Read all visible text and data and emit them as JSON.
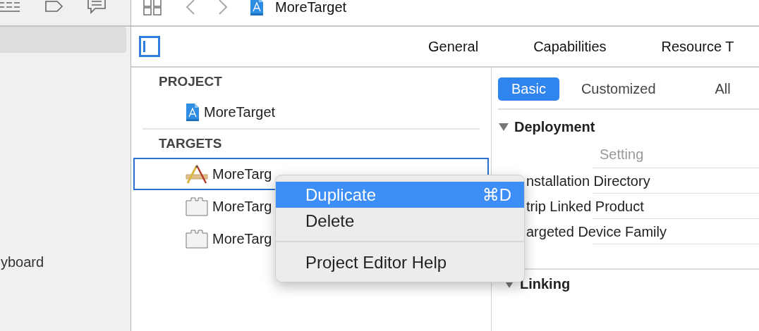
{
  "sidebar": {
    "items": [
      {
        "kind": "blank",
        "selected": true
      },
      {
        "kind": "text",
        "label": "yboard",
        "selected": false
      }
    ]
  },
  "toolbar": {
    "title": "MoreTarget"
  },
  "tabs": [
    {
      "label": "General",
      "selected": false
    },
    {
      "label": "Capabilities",
      "selected": false
    },
    {
      "label": "Resource T",
      "selected": false
    }
  ],
  "project_list": {
    "sections": [
      {
        "header": "PROJECT",
        "items": [
          {
            "kind": "project",
            "label": "MoreTarget",
            "selected": false
          }
        ]
      },
      {
        "header": "TARGETS",
        "items": [
          {
            "kind": "app",
            "label": "MoreTarg",
            "selected": true
          },
          {
            "kind": "extension",
            "label": "MoreTarg",
            "selected": false
          },
          {
            "kind": "extension",
            "label": "MoreTarg",
            "selected": false
          }
        ]
      }
    ]
  },
  "filters": [
    {
      "label": "Basic",
      "selected": true
    },
    {
      "label": "Customized",
      "selected": false
    },
    {
      "label": "All",
      "selected": false
    }
  ],
  "settings_sections": [
    {
      "title": "Deployment",
      "expanded": true,
      "column_header": "Setting",
      "rows": [
        "nstallation Directory",
        "trip Linked Product",
        "argeted Device Family"
      ]
    },
    {
      "title": "Linking",
      "expanded": true
    }
  ],
  "context_menu": {
    "items": [
      {
        "kind": "item",
        "label": "Duplicate",
        "shortcut": "⌘D",
        "selected": true
      },
      {
        "kind": "item",
        "label": "Delete",
        "selected": false
      },
      {
        "kind": "separator"
      },
      {
        "kind": "item",
        "label": "Project Editor Help",
        "selected": false
      }
    ]
  }
}
